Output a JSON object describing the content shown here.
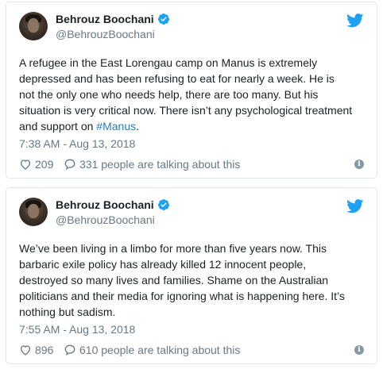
{
  "colors": {
    "link": "#2b7bb9",
    "muted": "#697882",
    "twitter_blue": "#1da1f2",
    "border": "#e1e8ed"
  },
  "tweets": [
    {
      "author": {
        "name": "Behrouz Boochani",
        "handle": "@BehrouzBoochani",
        "verified_icon": "verified-badge-icon",
        "avatar": "avatar-photo"
      },
      "text_before": "A refugee in the East Lorengau camp on Manus is extremely\ndepressed and has been refusing to eat for nearly a week. He is\nnot the only one who needs help, there are too many. But his\nsituation is very critical now. There isn’t any psychological treatment\nand support on ",
      "hashtag": "#Manus",
      "text_after": ".",
      "timestamp": "7:38 AM - Aug 13, 2018",
      "likes": "209",
      "talking": "331 people are talking about this"
    },
    {
      "author": {
        "name": "Behrouz Boochani",
        "handle": "@BehrouzBoochani",
        "verified_icon": "verified-badge-icon",
        "avatar": "avatar-photo"
      },
      "text_before": "We’ve been living in a limbo for more than five years now. This\nbarbaric exile policy has already killed 12 innocent people,\ndestroyed so many lives and families. Shame on the Australian\npoliticians and their media for ignoring what is happening here. It’s\nnothing but sadism.",
      "hashtag": "",
      "text_after": "",
      "timestamp": "7:55 AM - Aug 13, 2018",
      "likes": "896",
      "talking": "610 people are talking about this"
    }
  ]
}
